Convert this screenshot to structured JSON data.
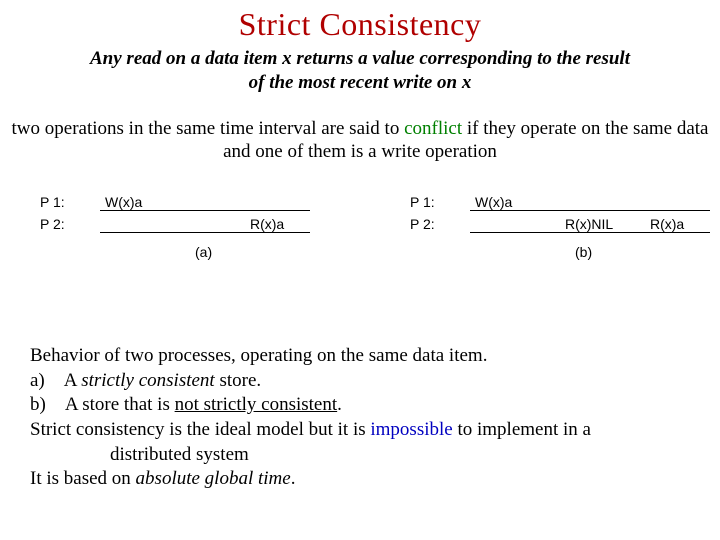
{
  "title": "Strict Consistency",
  "definition_l1": "Any read on a data item x returns a value corresponding to the result",
  "definition_l2": "of the most recent write on x",
  "conflict_pre": "two operations in the same time interval are said to ",
  "conflict_word": "conflict",
  "conflict_post": " if they operate on the same data and one of them is a write operation",
  "diag": {
    "p1": "P 1:",
    "p2": "P 2:",
    "wxa": "W(x)a",
    "rxa": "R(x)a",
    "rxnil": "R(x)NIL",
    "cap_a": "(a)",
    "cap_b": "(b)"
  },
  "beh": {
    "l1": "Behavior of two processes, operating on the same data item.",
    "a_lbl": "a)",
    "a_txt_pre": "A ",
    "a_txt_em": "strictly consistent",
    "a_txt_post": " store.",
    "b_lbl": "b)",
    "b_txt_pre": "A store that is ",
    "b_txt_u": "not strictly consistent",
    "b_txt_post": ".",
    "l4_pre": "Strict consistency is the ideal model but it is ",
    "l4_blue": "impossible",
    "l4_post": " to implement in a",
    "l5": "distributed system",
    "l6_pre": "It is based on ",
    "l6_em": "absolute global time",
    "l6_post": "."
  }
}
